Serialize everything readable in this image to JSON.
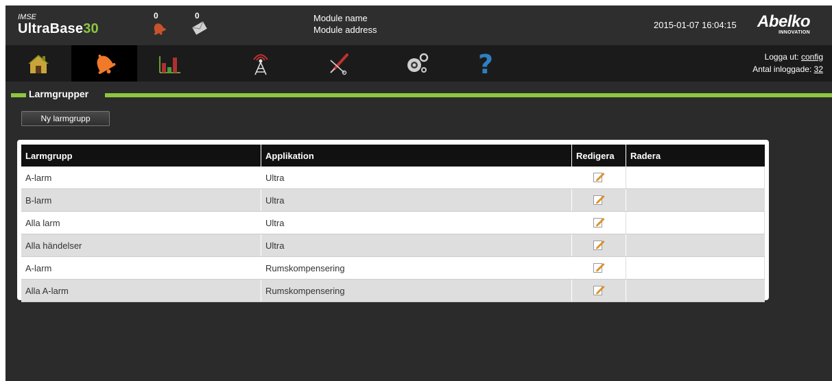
{
  "header": {
    "brand_top": "IMSE",
    "brand_main": "UltraBase",
    "brand_num": "30",
    "alarm_count": "0",
    "message_count": "0",
    "module_name": "Module name",
    "module_address": "Module address",
    "datetime": "2015-01-07 16:04:15",
    "logo_main": "Abelko",
    "logo_sub": "INNOVATION"
  },
  "nav": {
    "items": [
      {
        "icon": "home-icon"
      },
      {
        "icon": "alarm-bell-icon",
        "active": true
      },
      {
        "icon": "bar-chart-icon"
      },
      {
        "icon": "antenna-icon"
      },
      {
        "icon": "tools-icon"
      },
      {
        "icon": "gears-icon"
      },
      {
        "icon": "help-icon"
      }
    ],
    "logout_label": "Logga ut:",
    "logout_user": "config",
    "logged_in_label": "Antal inloggade:",
    "logged_in_count": "32"
  },
  "section": {
    "title": "Larmgrupper"
  },
  "toolbar": {
    "new_group_label": "Ny larmgrupp"
  },
  "table": {
    "headers": [
      "Larmgrupp",
      "Applikation",
      "Redigera",
      "Radera"
    ],
    "rows": [
      {
        "group": "A-larm",
        "app": "Ultra"
      },
      {
        "group": "B-larm",
        "app": "Ultra"
      },
      {
        "group": "Alla larm",
        "app": "Ultra"
      },
      {
        "group": "Alla händelser",
        "app": "Ultra"
      },
      {
        "group": "A-larm",
        "app": "Rumskompensering"
      },
      {
        "group": "Alla A-larm",
        "app": "Rumskompensering"
      }
    ]
  },
  "colors": {
    "accent": "#8cc63f",
    "header_bg": "#2e2e2e",
    "nav_bg": "#1b1b1b"
  }
}
